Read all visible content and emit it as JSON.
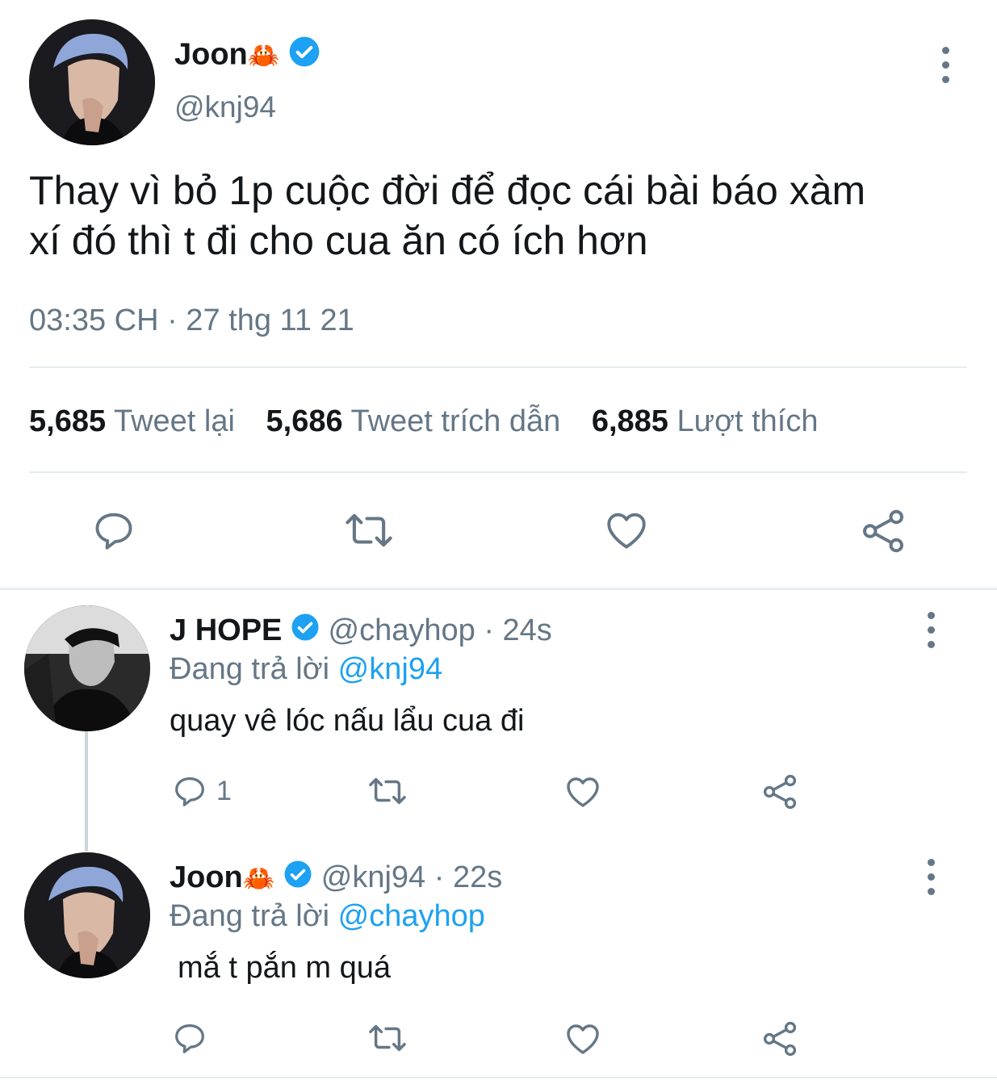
{
  "main_tweet": {
    "display_name": "Joon",
    "name_emoji": "🦀",
    "handle": "@knj94",
    "text_line1": "Thay vì bỏ 1p cuộc đời để đọc cái bài báo xàm",
    "text_line2": "xí đó thì t đi cho cua ăn có ích hơn",
    "timestamp": "03:35 CH · 27 thg 11 21",
    "stats": [
      {
        "count": "5,685",
        "label": "Tweet lại"
      },
      {
        "count": "5,686",
        "label": "Tweet trích dẫn"
      },
      {
        "count": "6,885",
        "label": "Lượt thích"
      }
    ]
  },
  "replies": [
    {
      "display_name": "J HOPE",
      "handle_time": "@chayhop · 24s",
      "replying_prefix": "Đang trả lời ",
      "replying_to": "@knj94",
      "text": "quay vê lóc nấu lẩu cua đi",
      "reply_count": "1"
    },
    {
      "display_name": "Joon",
      "name_emoji": "🦀",
      "handle_time": "@knj94 · 22s",
      "replying_prefix": "Đang trả lời ",
      "replying_to": "@chayhop",
      "text": "mắ t pắn m quá",
      "reply_count": ""
    }
  ],
  "colors": {
    "accent": "#1da1f2",
    "muted": "#657786",
    "text": "#14171a",
    "divider": "#e6ecf0"
  },
  "icons": [
    "reply-icon",
    "retweet-icon",
    "like-icon",
    "share-icon",
    "verified-badge-icon",
    "more-options-icon",
    "crab-emoji"
  ]
}
